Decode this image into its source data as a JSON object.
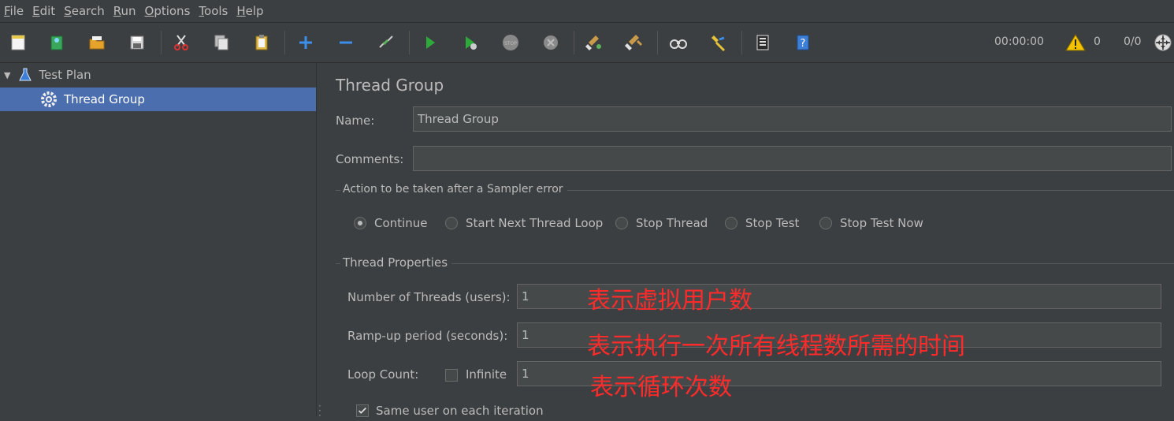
{
  "menu": {
    "file": "File",
    "edit": "Edit",
    "search": "Search",
    "run": "Run",
    "options": "Options",
    "tools": "Tools",
    "help": "Help"
  },
  "toolbar": {
    "timer": "00:00:00",
    "warning_count": "0",
    "ratio": "0/0",
    "icons": [
      "new-icon",
      "templates-icon",
      "open-icon",
      "save-icon",
      "cut-icon",
      "copy-icon",
      "paste-icon",
      "expand-icon",
      "collapse-icon",
      "toggle-icon",
      "start-icon",
      "start-no-pause-icon",
      "stop-icon",
      "shutdown-icon",
      "clear-icon",
      "clear-all-icon",
      "search-icon",
      "reset-search-icon",
      "function-helper-icon",
      "help-icon"
    ]
  },
  "tree": {
    "root": "Test Plan",
    "child": "Thread Group"
  },
  "panel": {
    "title": "Thread Group",
    "name_label": "Name:",
    "name_value": "Thread Group",
    "comments_label": "Comments:",
    "comments_value": "",
    "error_group_label": "Action to be taken after a Sampler error",
    "radios": [
      "Continue",
      "Start Next Thread Loop",
      "Stop Thread",
      "Stop Test",
      "Stop Test Now"
    ],
    "selected_radio": "Continue",
    "thread_props_label": "Thread Properties",
    "threads_label": "Number of Threads (users):",
    "threads_value": "1",
    "rampup_label": "Ramp-up period (seconds):",
    "rampup_value": "1",
    "loop_label": "Loop Count:",
    "infinite_label": "Infinite",
    "infinite_checked": false,
    "loop_value": "1",
    "same_user_label": "Same user on each iteration",
    "same_user_checked": true
  },
  "annotations": {
    "threads": "表示虚拟用户数",
    "rampup": "表示执行一次所有线程数所需的时间",
    "loop": "表示循环次数"
  },
  "colors": {
    "background": "#3c3f41",
    "selection": "#4b6eaf",
    "field": "#45494a",
    "annotation": "#ff2a2a"
  }
}
